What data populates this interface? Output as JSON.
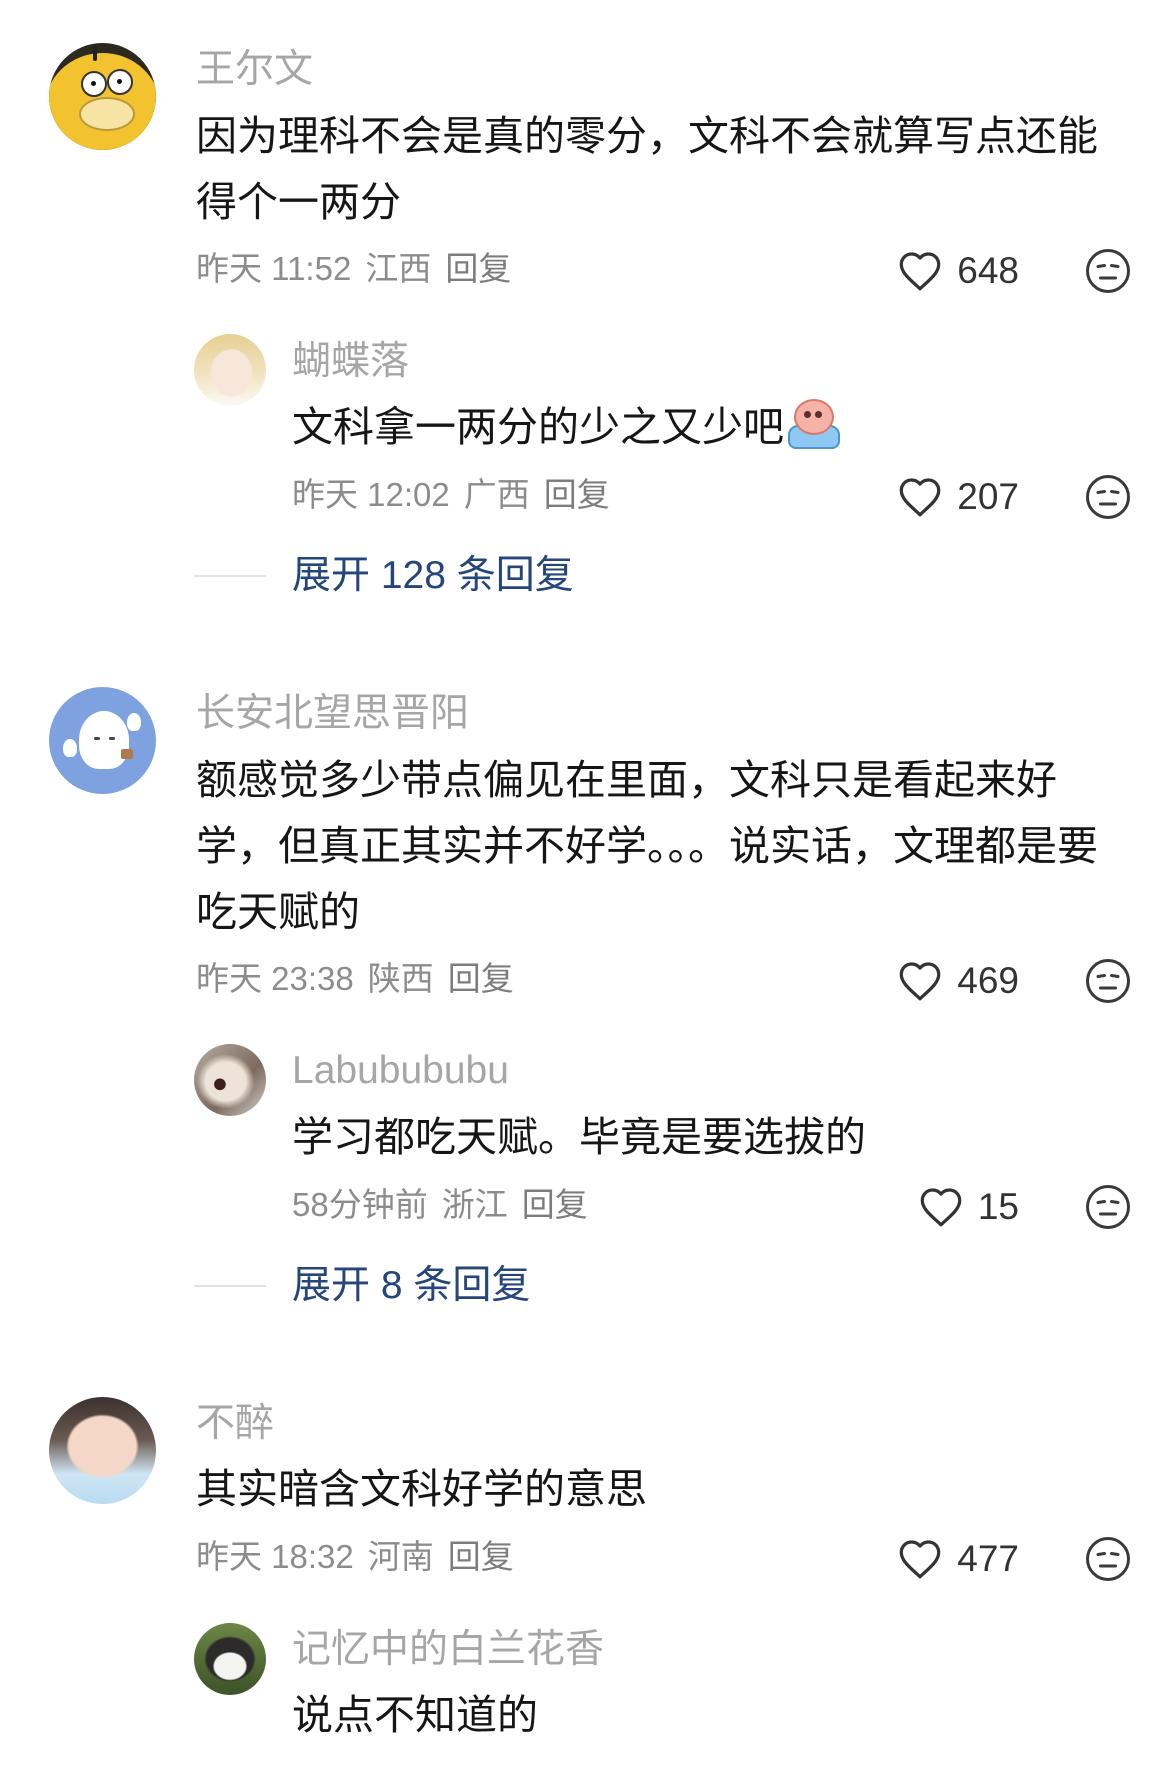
{
  "colors": {
    "background": "#ffffff",
    "username": "#a6a6a6",
    "text": "#161616",
    "meta": "#8c8c8c",
    "expand_link": "#24467a"
  },
  "comments": [
    {
      "avatar_icon": "psyduck-avatar",
      "username": "王尔文",
      "text": "因为理科不会是真的零分，文科不会就算写点还能得个一两分",
      "time": "昨天 11:52",
      "location": "江西",
      "reply_label": "回复",
      "likes": "648",
      "replies": [
        {
          "avatar_icon": "blonde-girl-avatar",
          "username": "蝴蝶落",
          "text": "文科拿一两分的少之又少吧",
          "emoji": "crying-face-emoji",
          "time": "昨天 12:02",
          "location": "广西",
          "reply_label": "回复",
          "likes": "207"
        }
      ],
      "expand_label": "展开 128 条回复"
    },
    {
      "avatar_icon": "ghost-avatar",
      "username": "长安北望思晋阳",
      "text": "额感觉多少带点偏见在里面，文科只是看起来好学，但真正其实并不好学。。。说实话，文理都是要吃天赋的",
      "time": "昨天 23:38",
      "location": "陕西",
      "reply_label": "回复",
      "likes": "469",
      "replies": [
        {
          "avatar_icon": "screaming-cat-avatar",
          "username": "Labubububu",
          "text": "学习都吃天赋。毕竟是要选拔的",
          "time": "58分钟前",
          "location": "浙江",
          "reply_label": "回复",
          "likes": "15"
        }
      ],
      "expand_label": "展开 8 条回复"
    },
    {
      "avatar_icon": "smiling-girl-avatar",
      "username": "不醉",
      "text": "其实暗含文科好学的意思",
      "time": "昨天 18:32",
      "location": "河南",
      "reply_label": "回复",
      "likes": "477",
      "replies": [
        {
          "avatar_icon": "cat-avatar",
          "username": "记忆中的白兰花香",
          "text": "说点不知道的"
        }
      ]
    }
  ]
}
